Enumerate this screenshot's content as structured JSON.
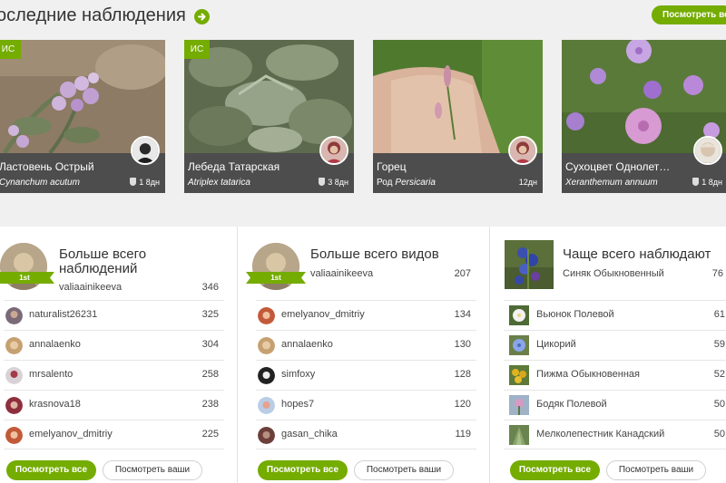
{
  "header": {
    "title": "оследние наблюдения",
    "view_all_label": "Посмотреть все",
    "accent_color": "#74ac00"
  },
  "observations": [
    {
      "common_name": "Ластовень Острый",
      "rank": "",
      "sci_name": "Cynanchum acutum",
      "ids": "1",
      "age": "8дн",
      "badge": "ИС",
      "icon": "shield-icon"
    },
    {
      "common_name": "Лебеда Татарская",
      "rank": "",
      "sci_name": "Atriplex tatarica",
      "ids": "3",
      "age": "8дн",
      "badge": "ИС",
      "icon": "shield-icon"
    },
    {
      "common_name": "Горец",
      "rank": "Род",
      "sci_name": "Persicaria",
      "ids": "",
      "age": "12дн",
      "badge": "",
      "icon": ""
    },
    {
      "common_name": "Сухоцвет Однолет…",
      "rank": "",
      "sci_name": "Xeranthemum annuum",
      "ids": "1",
      "age": "8дн",
      "badge": "",
      "icon": "shield-icon"
    }
  ],
  "panels": {
    "observers": {
      "title": "Больше всего наблюдений",
      "ribbon": "1st",
      "leader": {
        "name": "valiaainikeeva",
        "count": "346"
      },
      "rows": [
        {
          "name": "naturalist26231",
          "count": "325"
        },
        {
          "name": "annalaenko",
          "count": "304"
        },
        {
          "name": "mrsalento",
          "count": "258"
        },
        {
          "name": "krasnova18",
          "count": "238"
        },
        {
          "name": "emelyanov_dmitriy",
          "count": "225"
        }
      ],
      "view_all": "Посмотреть все",
      "view_yours": "Посмотреть ваши"
    },
    "species": {
      "title": "Больше всего видов",
      "ribbon": "1st",
      "leader": {
        "name": "valiaainikeeva",
        "count": "207"
      },
      "rows": [
        {
          "name": "emelyanov_dmitriy",
          "count": "134"
        },
        {
          "name": "annalaenko",
          "count": "130"
        },
        {
          "name": "simfoxy",
          "count": "128"
        },
        {
          "name": "hopes7",
          "count": "120"
        },
        {
          "name": "gasan_chika",
          "count": "119"
        }
      ],
      "view_all": "Посмотреть все",
      "view_yours": "Посмотреть ваши"
    },
    "most_observed": {
      "title": "Чаще всего наблюдают",
      "leader": {
        "name": "Синяк Обыкновенный",
        "count": "76"
      },
      "rows": [
        {
          "name": "Вьюнок Полевой",
          "count": "61"
        },
        {
          "name": "Цикорий",
          "count": "59"
        },
        {
          "name": "Пижма Обыкновенная",
          "count": "52"
        },
        {
          "name": "Бодяк Полевой",
          "count": "50"
        },
        {
          "name": "Мелколепестник Канадский",
          "count": "50"
        }
      ],
      "view_all": "Посмотреть все",
      "view_yours": "Посмотреть ваши"
    }
  }
}
